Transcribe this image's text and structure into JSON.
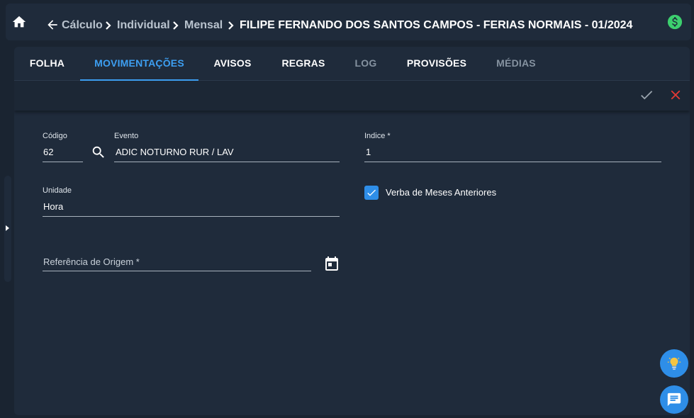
{
  "header": {
    "breadcrumbs": [
      "Cálculo",
      "Individual",
      "Mensal"
    ],
    "title": "FILIPE FERNANDO DOS SANTOS CAMPOS - FERIAS NORMAIS - 01/2024"
  },
  "tabs": [
    {
      "label": "FOLHA",
      "state": "normal"
    },
    {
      "label": "MOVIMENTAÇÕES",
      "state": "active"
    },
    {
      "label": "AVISOS",
      "state": "normal"
    },
    {
      "label": "REGRAS",
      "state": "normal"
    },
    {
      "label": "LOG",
      "state": "disabled"
    },
    {
      "label": "PROVISÕES",
      "state": "normal"
    },
    {
      "label": "MÉDIAS",
      "state": "disabled"
    }
  ],
  "form": {
    "codigo": {
      "label": "Código",
      "value": "62"
    },
    "evento": {
      "label": "Evento",
      "value": "ADIC NOTURNO RUR / LAV"
    },
    "indice": {
      "label": "Indice *",
      "value": "1"
    },
    "unidade": {
      "label": "Unidade",
      "value": "Hora"
    },
    "verba": {
      "label": "Verba de Meses Anteriores",
      "checked": true
    },
    "referencia": {
      "label": "Referência de Origem *",
      "value": ""
    }
  },
  "colors": {
    "accent": "#3d9ff2",
    "danger": "#e53935",
    "money": "#3ccf6e",
    "background": "#1a2431",
    "panel": "#1f2b3b"
  },
  "icons": [
    "home-icon",
    "back-arrow-icon",
    "chevron-right-icon",
    "money-icon",
    "check-icon",
    "close-icon",
    "search-icon",
    "calendar-icon",
    "lightbulb-icon",
    "chat-icon"
  ]
}
